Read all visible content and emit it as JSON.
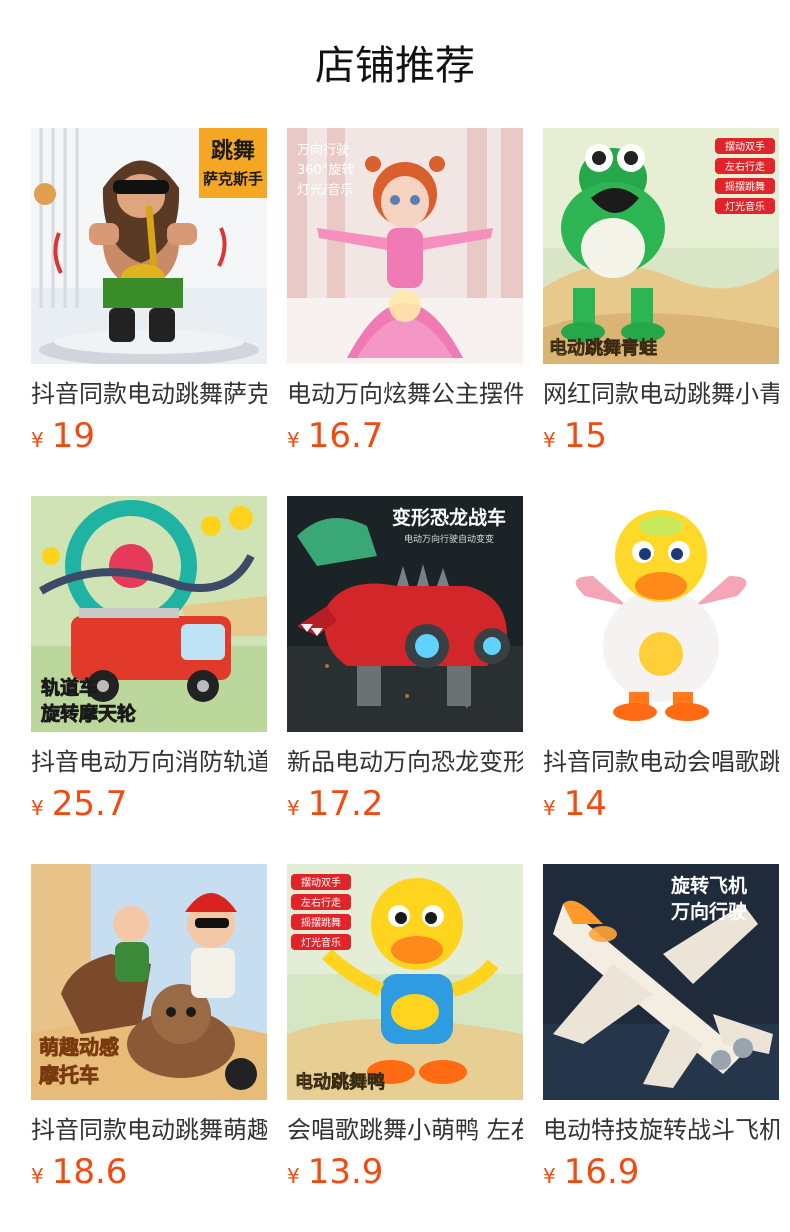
{
  "section": {
    "title": "店铺推荐"
  },
  "products": [
    {
      "title": "抖音同款电动跳舞萨克斯手",
      "currency": "¥",
      "price": "19",
      "image_text": [
        "跳舞",
        "萨克斯手"
      ]
    },
    {
      "title": "电动万向炫舞公主摆件",
      "currency": "¥",
      "price": "16.7",
      "image_text": [
        "万向行驶",
        "360°旋转",
        "灯光/音乐"
      ]
    },
    {
      "title": "网红同款电动跳舞小青蛙",
      "currency": "¥",
      "price": "15",
      "image_text": [
        "摆动双手",
        "左右行走",
        "摇摆跳舞",
        "灯光音乐",
        "电动跳舞青蛙"
      ]
    },
    {
      "title": "抖音电动万向消防轨道车",
      "currency": "¥",
      "price": "25.7",
      "image_text": [
        "轨道车",
        "旋转摩天轮"
      ]
    },
    {
      "title": "新品电动万向恐龙变形战车",
      "currency": "¥",
      "price": "17.2",
      "image_text": [
        "变形恐龙战车",
        "电动万向行驶自动变变"
      ]
    },
    {
      "title": "抖音同款电动会唱歌跳舞鸭",
      "currency": "¥",
      "price": "14",
      "image_text": []
    },
    {
      "title": "抖音同款电动跳舞萌趣摩托车",
      "currency": "¥",
      "price": "18.6",
      "image_text": [
        "萌趣动感",
        "摩托车"
      ]
    },
    {
      "title": "会唱歌跳舞小萌鸭 左右行走",
      "currency": "¥",
      "price": "13.9",
      "image_text": [
        "摆动双手",
        "左右行走",
        "摇摆跳舞",
        "灯光音乐",
        "电动跳舞鸭"
      ]
    },
    {
      "title": "电动特技旋转战斗飞机",
      "currency": "¥",
      "price": "16.9",
      "image_text": [
        "旋转飞机",
        "万向行驶"
      ]
    }
  ]
}
